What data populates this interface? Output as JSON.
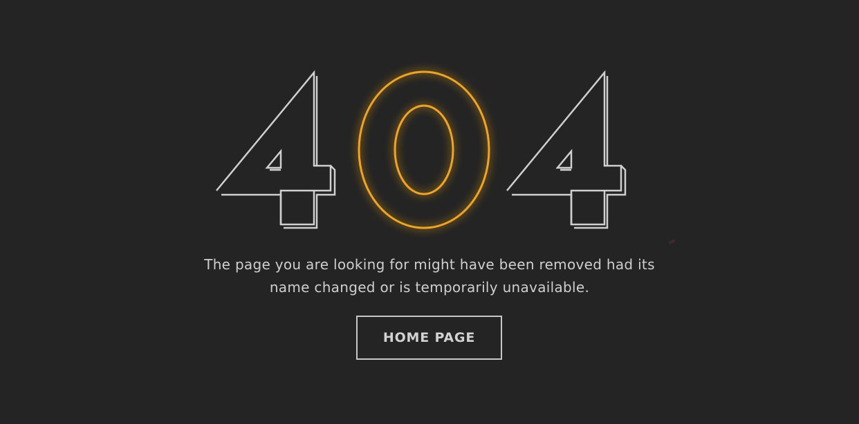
{
  "error_code": {
    "first_digit": "4",
    "middle_digit": "0",
    "last_digit": "4"
  },
  "message": {
    "line1": "The page you are looking for might have been removed had its",
    "line2": "name changed or is temporarily unavailable."
  },
  "actions": {
    "home_label": "HOME PAGE"
  },
  "colors": {
    "background": "#242424",
    "outline": "#d0d0d0",
    "accent_glow": "#f2a51f",
    "text": "#cfcfcf"
  }
}
